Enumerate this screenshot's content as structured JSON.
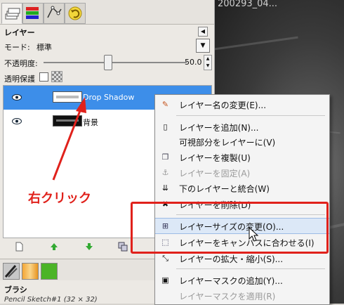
{
  "canvas": {
    "title": "200293_04..."
  },
  "dock": {
    "tabs": [
      {
        "icon": "layers-icon",
        "active": true
      },
      {
        "icon": "channels-icon"
      },
      {
        "icon": "paths-icon"
      },
      {
        "icon": "undo-history-icon"
      }
    ],
    "panel_title": "レイヤー",
    "mode_label": "モード:",
    "mode_value": "標準",
    "opacity_label": "不透明度:",
    "opacity_value": "50.0",
    "opacity_fraction": 0.5,
    "lock_label": "透明保護",
    "layers": [
      {
        "name": "Drop Shadow",
        "selected": true,
        "visible": true
      },
      {
        "name": "背景",
        "selected": false,
        "visible": true
      }
    ],
    "toolbar_icons": [
      "new-layer-icon",
      "raise-layer-icon",
      "lower-layer-icon",
      "duplicate-layer-icon"
    ],
    "brush_tabs": [
      "brushes-icon",
      "patterns-icon",
      "gradients-icon"
    ],
    "brush_title": "ブラシ",
    "brush_name": "Pencil Sketch#1 (32 × 32)"
  },
  "annotation": {
    "label": "右クリック",
    "color": "#e0211b"
  },
  "menu": {
    "items": [
      {
        "label": "レイヤー名の変更(E)...",
        "icon": "pencil-icon",
        "disabled": false
      },
      {
        "sep": true
      },
      {
        "label": "レイヤーを追加(N)...",
        "icon": "new-layer-icon",
        "disabled": false
      },
      {
        "label": "可視部分をレイヤーに(V)",
        "icon": "",
        "disabled": false
      },
      {
        "label": "レイヤーを複製(U)",
        "icon": "duplicate-layer-icon",
        "disabled": false
      },
      {
        "label": "レイヤーを固定(A)",
        "icon": "anchor-icon",
        "disabled": true
      },
      {
        "label": "下のレイヤーと統合(W)",
        "icon": "merge-down-icon",
        "disabled": false
      },
      {
        "label": "レイヤーを削除(D)",
        "icon": "delete-layer-icon",
        "disabled": false
      },
      {
        "sep": true
      },
      {
        "label": "レイヤーサイズの変更(O)...",
        "icon": "layer-boundary-size-icon",
        "disabled": false,
        "hover": true
      },
      {
        "label": "レイヤーをキャンバスに合わせる(I)",
        "icon": "layer-to-image-size-icon",
        "disabled": false
      },
      {
        "label": "レイヤーの拡大・縮小(S)...",
        "icon": "scale-layer-icon",
        "disabled": false
      },
      {
        "sep": true
      },
      {
        "label": "レイヤーマスクの追加(Y)...",
        "icon": "add-mask-icon",
        "disabled": false
      },
      {
        "label": "レイヤーマスクを適用(R)",
        "icon": "",
        "disabled": true
      }
    ]
  }
}
